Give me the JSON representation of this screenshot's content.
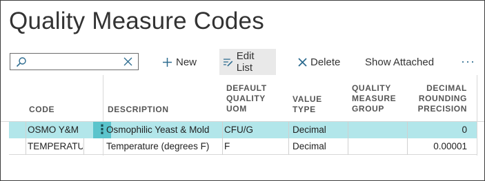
{
  "page": {
    "title": "Quality Measure Codes"
  },
  "search": {
    "value": ""
  },
  "actions": {
    "new_label": "New",
    "edit_list_label": "Edit List",
    "delete_label": "Delete",
    "show_attached_label": "Show Attached",
    "more_label": "···"
  },
  "columns": [
    [
      "CODE"
    ],
    [
      "DESCRIPTION"
    ],
    [
      "DEFAULT",
      "QUALITY",
      "UOM"
    ],
    [
      "VALUE",
      "TYPE"
    ],
    [
      "QUALITY",
      "MEASURE",
      "GROUP"
    ],
    [
      "DECIMAL",
      "ROUNDING",
      "PRECISION"
    ]
  ],
  "rows": [
    {
      "code": "OSMO Y&M",
      "description": "Osmophilic Yeast & Mold",
      "uom": "CFU/G",
      "value_type": "Decimal",
      "group": "",
      "precision": "0"
    },
    {
      "code": "TEMPERATUR",
      "description": "Temperature (degrees F)",
      "uom": "F",
      "value_type": "Decimal",
      "group": "",
      "precision": "0.00001"
    }
  ],
  "row_menu_label": "⋮",
  "colors": {
    "selected_row": "#b2e6ea",
    "row_menu": "#5bc4cc",
    "accent": "#2c6b8f"
  }
}
